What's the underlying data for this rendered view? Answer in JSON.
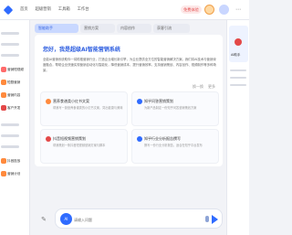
{
  "topbar": {
    "nav": [
      "首页",
      "超级营销",
      "工具箱",
      "工作台"
    ],
    "login_badge": "免费体验",
    "more_label": "⋯"
  },
  "sidebar": {
    "items": [
      {
        "label": "",
        "color": "#f2d6b3"
      },
      {
        "label": "",
        "color": "#f2d6b3"
      },
      {
        "label": "",
        "color": "#f2d6b3"
      },
      {
        "label": "营销短视频",
        "color": "#ff6b6b"
      },
      {
        "label": "短剧营销",
        "color": "#ff8a3d"
      },
      {
        "label": "营销内容",
        "color": "#ff8a3d"
      },
      {
        "label": "客户开发",
        "color": "#e34848"
      },
      {
        "label": "",
        "color": "#f2d6b3"
      },
      {
        "label": "",
        "color": "#f2d6b3"
      },
      {
        "label": "",
        "color": "#f2d6b3"
      },
      {
        "label": "抖音投放",
        "color": "#ff8a3d"
      },
      {
        "label": "营销计划",
        "color": "#ff8a3d"
      }
    ]
  },
  "tabs": [
    {
      "label": "智能助手",
      "active": true
    },
    {
      "label": "营销方案",
      "active": false
    },
    {
      "label": "内容创作",
      "active": false
    },
    {
      "label": "获客引流",
      "active": false
    }
  ],
  "welcome": {
    "title": "您好，我是超级AI智能营销系统",
    "desc": "全能AI营销系统助你一臂助推营销行业，打造企业增长新引擎，为企业提供全方位的智能营销解决方案。我们将AI技术与营销深度融合，帮助企业快速实现营销自动化与智能化，降低营销成本，提升营销效率。支持营销策划、内容创作、视频制作等多种场景。",
    "refresh": [
      "换一换",
      "更多"
    ]
  },
  "cards": [
    {
      "title": "营养食谱类小红书文案",
      "desc": "帮我写一篇营养食谱类的小红书文案，突出健康与美味"
    },
    {
      "title": "知乎问答营销策划",
      "desc": "为新产品制定一份知乎问答营销策划方案"
    },
    {
      "title": "抖音短视频营销策划",
      "desc": "帮我策划一条抖音短视频营销方案与脚本"
    },
    {
      "title": "知乎行业分析报告撰写",
      "desc": "撰写一份行业分析报告，适合在知乎平台发布"
    }
  ],
  "input": {
    "placeholder": "请输入问题",
    "ai_label": "AI"
  },
  "rightpanel": {
    "label": "AI助手"
  },
  "colors": {
    "accent": "#2f6bff",
    "danger": "#e34848"
  }
}
